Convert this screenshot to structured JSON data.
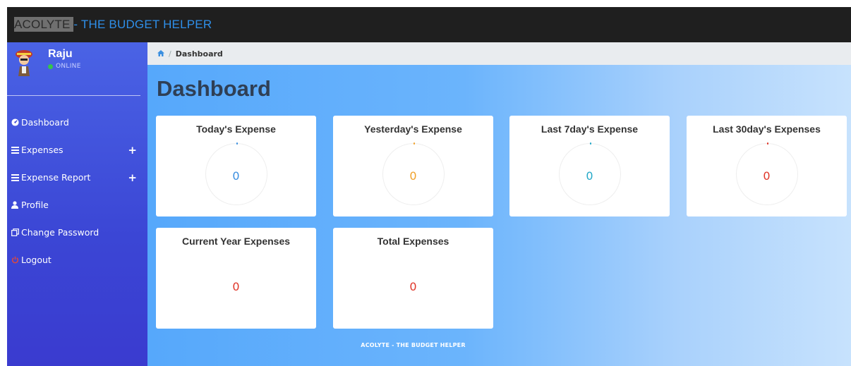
{
  "header": {
    "brand_highlight": "ACOLYTE ",
    "brand_rest": "- THE BUDGET HELPER"
  },
  "user": {
    "name": "Raju",
    "status": "ONLINE"
  },
  "sidebar": {
    "items": [
      {
        "label": "Dashboard",
        "icon": "dashboard-icon"
      },
      {
        "label": "Expenses",
        "icon": "list-icon"
      },
      {
        "label": "Expense Report",
        "icon": "list-icon"
      },
      {
        "label": "Profile",
        "icon": "user-icon"
      },
      {
        "label": "Change Password",
        "icon": "copy-icon"
      },
      {
        "label": "Logout",
        "icon": "power-icon"
      }
    ]
  },
  "breadcrumb": {
    "current": "Dashboard"
  },
  "page": {
    "title": "Dashboard"
  },
  "cards": [
    {
      "title": "Today's Expense",
      "value": "0",
      "color": "#3b8fe0"
    },
    {
      "title": "Yesterday's Expense",
      "value": "0",
      "color": "#f0a22c"
    },
    {
      "title": "Last 7day's Expense",
      "value": "0",
      "color": "#25a9c8"
    },
    {
      "title": "Last 30day's Expenses",
      "value": "0",
      "color": "#e0372a"
    },
    {
      "title": "Current Year Expenses",
      "value": "0",
      "color": "#e0372a"
    },
    {
      "title": "Total Expenses",
      "value": "0",
      "color": "#e0372a"
    }
  ],
  "footer": {
    "text": "ACOLYTE - THE BUDGET HELPER"
  }
}
